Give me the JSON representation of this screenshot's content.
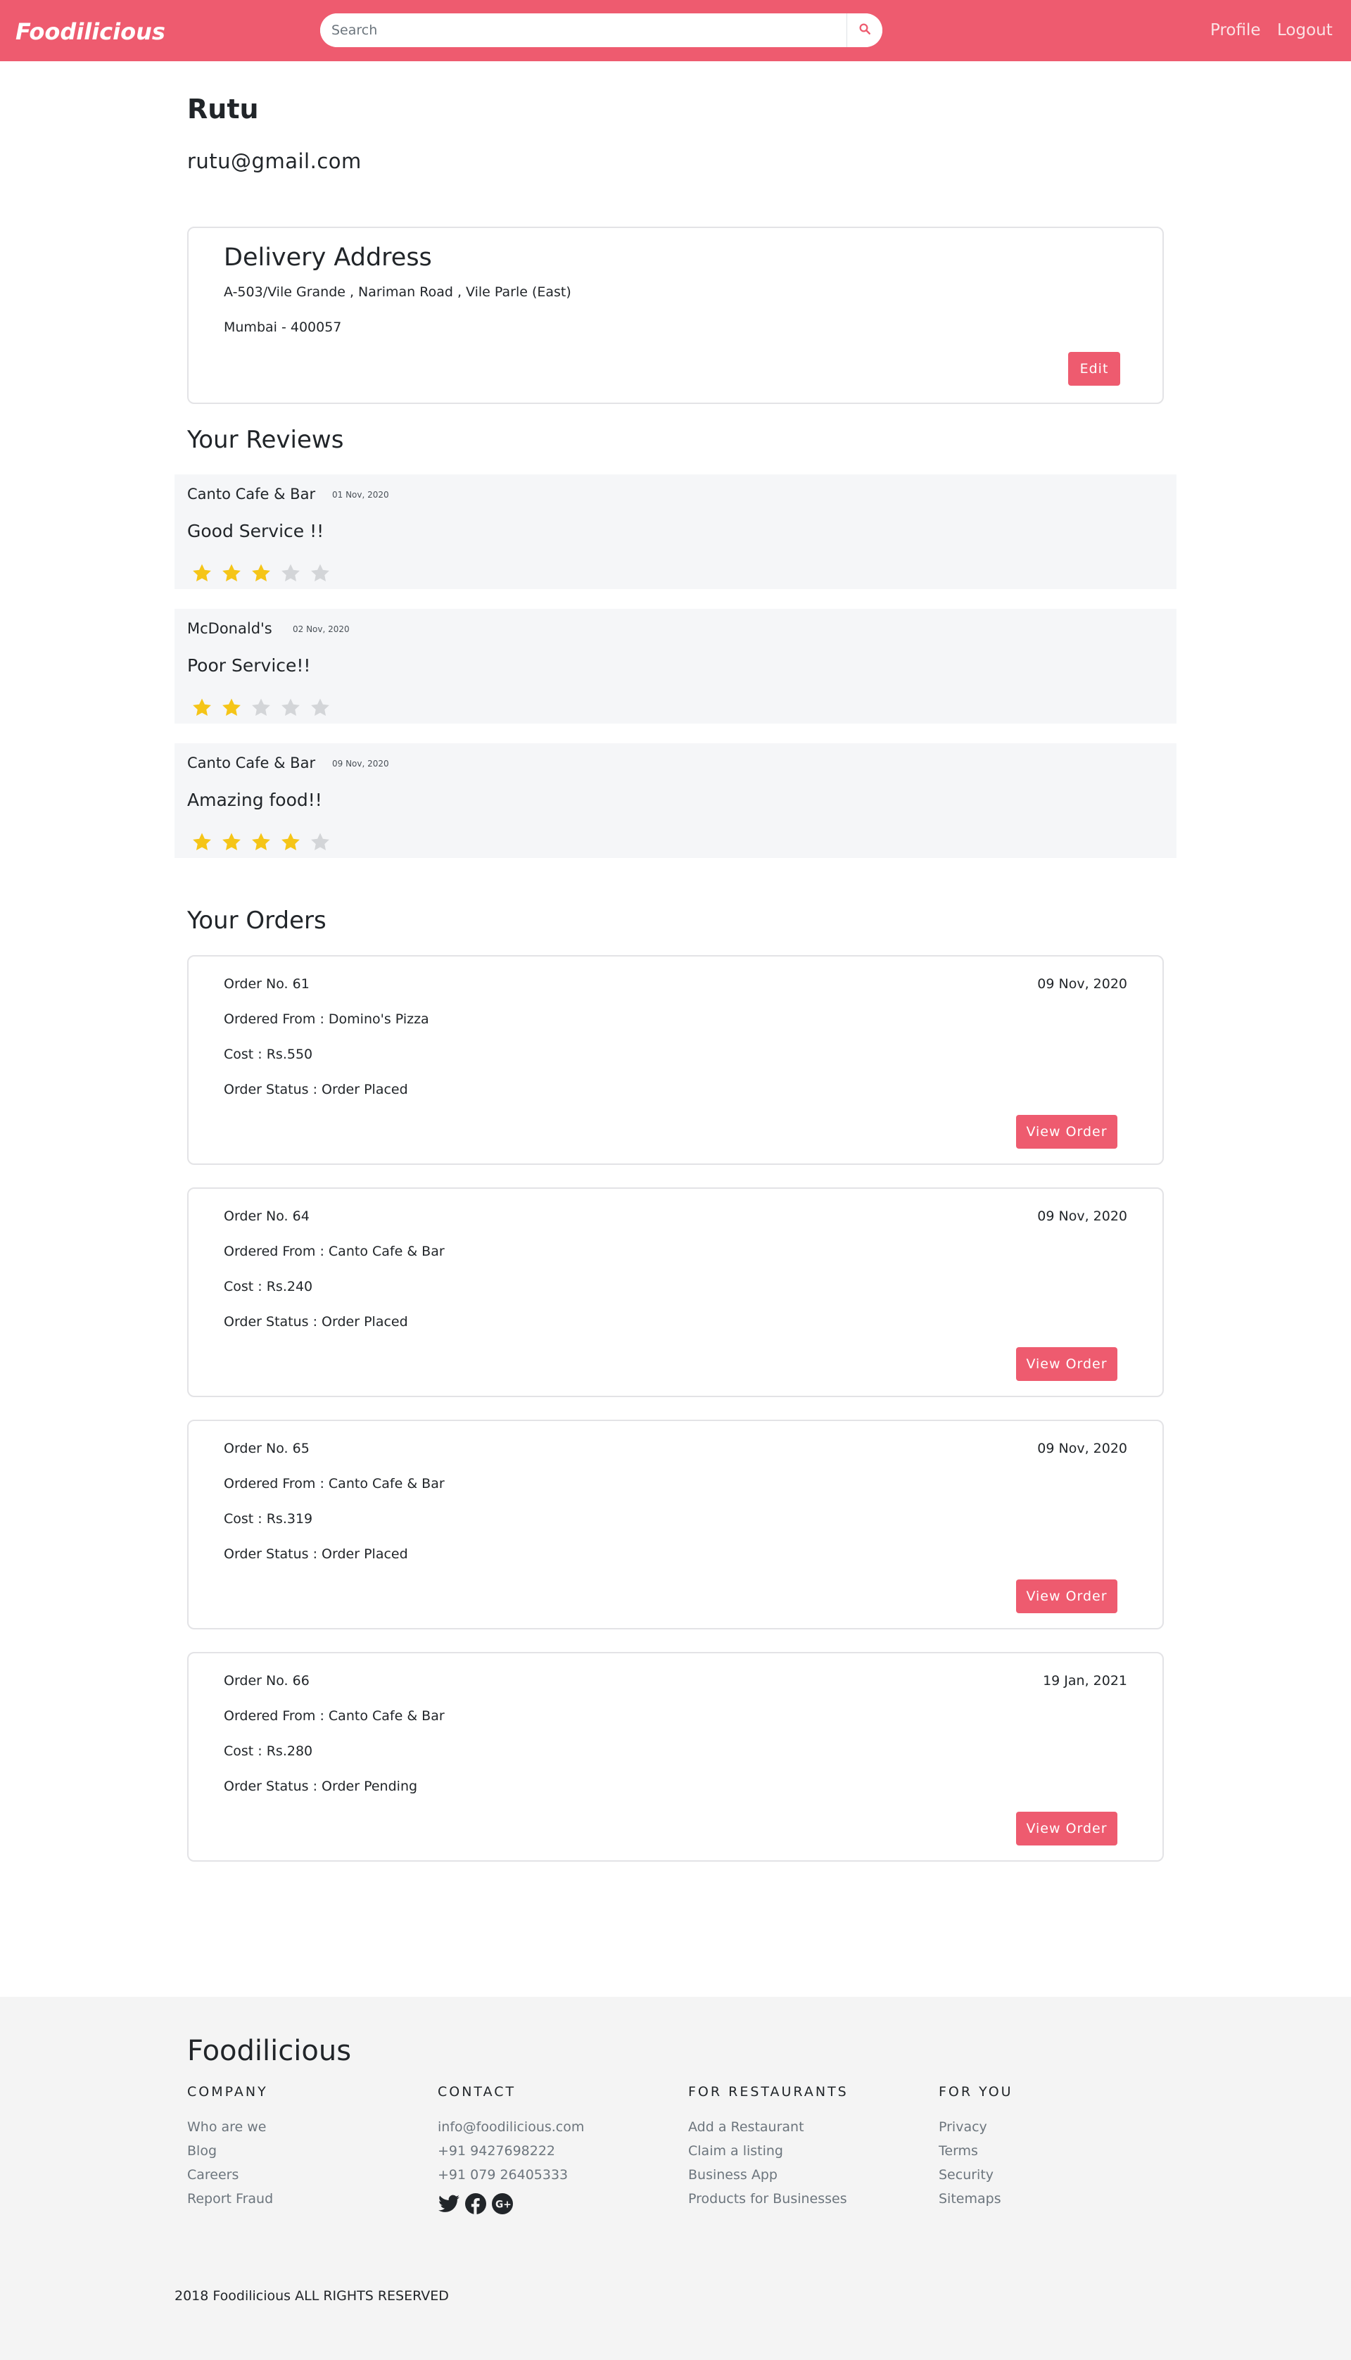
{
  "navbar": {
    "brand": "Foodilicious",
    "search_placeholder": "Search",
    "search_icon": "search-icon",
    "links": [
      "Profile",
      "Logout"
    ]
  },
  "colors": {
    "accent": "#ee5b6f",
    "star_filled": "#f5c518",
    "star_empty": "#d3d5d8",
    "review_bg": "#f5f6f8",
    "footer_bg": "#f4f4f4"
  },
  "profile": {
    "name": "Rutu",
    "email": "rutu@gmail.com"
  },
  "address": {
    "title": "Delivery Address",
    "line1": "A-503/Vile Grande , Nariman Road , Vile Parle (East)",
    "line2": "Mumbai - 400057",
    "edit_label": "Edit"
  },
  "reviews": {
    "title": "Your Reviews",
    "items": [
      {
        "restaurant": "Canto Cafe & Bar",
        "date": "01 Nov, 2020",
        "text": "Good Service !!",
        "rating": 3,
        "max": 5
      },
      {
        "restaurant": "McDonald's",
        "date": "02 Nov, 2020",
        "text": "Poor Service!!",
        "rating": 2,
        "max": 5
      },
      {
        "restaurant": "Canto Cafe & Bar",
        "date": "09 Nov, 2020",
        "text": "Amazing food!!",
        "rating": 4,
        "max": 5
      }
    ]
  },
  "orders": {
    "title": "Your Orders",
    "view_label": "View Order",
    "items": [
      {
        "number": "Order No. 61",
        "date": "09 Nov, 2020",
        "from": "Ordered From : Domino's Pizza",
        "cost": "Cost : Rs.550",
        "status": "Order Status : Order Placed"
      },
      {
        "number": "Order No. 64",
        "date": "09 Nov, 2020",
        "from": "Ordered From : Canto Cafe & Bar",
        "cost": "Cost : Rs.240",
        "status": "Order Status : Order Placed"
      },
      {
        "number": "Order No. 65",
        "date": "09 Nov, 2020",
        "from": "Ordered From : Canto Cafe & Bar",
        "cost": "Cost : Rs.319",
        "status": "Order Status : Order Placed"
      },
      {
        "number": "Order No. 66",
        "date": "19 Jan, 2021",
        "from": "Ordered From : Canto Cafe & Bar",
        "cost": "Cost : Rs.280",
        "status": "Order Status : Order Pending"
      }
    ]
  },
  "footer": {
    "brand": "Foodilicious",
    "columns": [
      {
        "heading": "COMPANY",
        "items": [
          "Who are we",
          "Blog",
          "Careers",
          "Report Fraud"
        ]
      },
      {
        "heading": "CONTACT",
        "items": [
          "info@foodilicious.com",
          "+91 9427698222",
          "+91 079 26405333"
        ]
      },
      {
        "heading": "FOR RESTAURANTS",
        "items": [
          "Add a Restaurant",
          "Claim a listing",
          "Business App",
          "Products for Businesses"
        ]
      },
      {
        "heading": "FOR YOU",
        "items": [
          "Privacy",
          "Terms",
          "Security",
          "Sitemaps"
        ]
      }
    ],
    "social_icons": [
      "twitter-icon",
      "facebook-icon",
      "google-plus-icon"
    ],
    "copyright": "2018 Foodilicious ALL RIGHTS RESERVED"
  }
}
